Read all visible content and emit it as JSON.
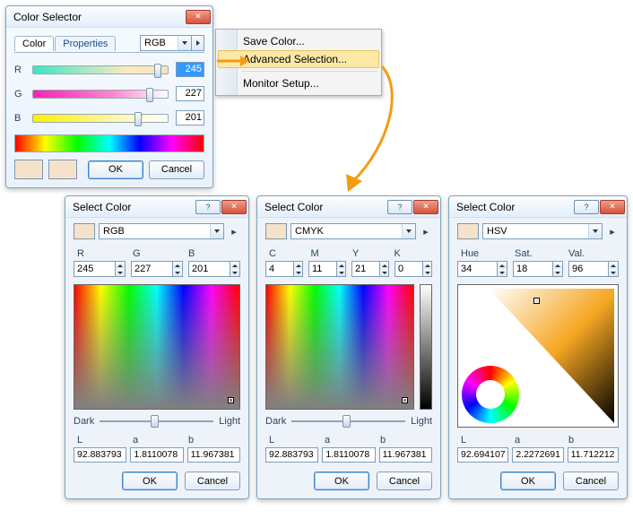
{
  "colorSelector": {
    "title": "Color Selector",
    "tabs": {
      "color": "Color",
      "properties": "Properties"
    },
    "mode": "RGB",
    "channels": {
      "r": "R",
      "g": "G",
      "b": "B"
    },
    "values": {
      "r": "245",
      "g": "227",
      "b": "201"
    },
    "ok": "OK",
    "cancel": "Cancel"
  },
  "menu": {
    "saveColor": "Save Color...",
    "advanced": "Advanced Selection...",
    "monitor": "Monitor Setup..."
  },
  "sc_rgb": {
    "title": "Select Color",
    "mode": "RGB",
    "heads": {
      "r": "R",
      "g": "G",
      "b": "B"
    },
    "vals": {
      "r": "245",
      "g": "227",
      "b": "201"
    },
    "dark": "Dark",
    "light": "Light",
    "labheads": {
      "L": "L",
      "a": "a",
      "b": "b"
    },
    "lab": {
      "L": "92.883793",
      "a": "1.8110078",
      "b": "11.967381"
    },
    "ok": "OK",
    "cancel": "Cancel"
  },
  "sc_cmyk": {
    "title": "Select Color",
    "mode": "CMYK",
    "heads": {
      "c": "C",
      "m": "M",
      "y": "Y",
      "k": "K"
    },
    "vals": {
      "c": "4",
      "m": "11",
      "y": "21",
      "k": "0"
    },
    "dark": "Dark",
    "light": "Light",
    "labheads": {
      "L": "L",
      "a": "a",
      "b": "b"
    },
    "lab": {
      "L": "92.883793",
      "a": "1.8110078",
      "b": "11.967381"
    },
    "ok": "OK",
    "cancel": "Cancel"
  },
  "sc_hsv": {
    "title": "Select Color",
    "mode": "HSV",
    "heads": {
      "h": "Hue",
      "s": "Sat.",
      "v": "Val."
    },
    "vals": {
      "h": "34",
      "s": "18",
      "v": "96"
    },
    "labheads": {
      "L": "L",
      "a": "a",
      "b": "b"
    },
    "lab": {
      "L": "92.694107",
      "a": "2.2272691",
      "b": "11.712212"
    },
    "ok": "OK",
    "cancel": "Cancel"
  }
}
